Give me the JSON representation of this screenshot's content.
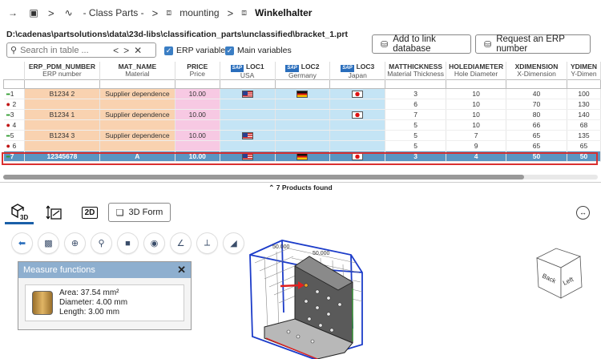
{
  "breadcrumb": {
    "items": [
      "- Class Parts -",
      "mounting",
      "Winkelhalter"
    ],
    "sep": ">"
  },
  "toolbar": {
    "path": "D:\\cadenas\\partsolutions\\data\\23d-libs\\classification_parts\\unclassified\\bracket_1.prt",
    "search_placeholder": "Search in table ...",
    "erp_variables": "ERP variables",
    "main_variables": "Main variables",
    "add_link_db": "Add to link database",
    "request_erp": "Request an ERP number"
  },
  "table": {
    "columns": [
      {
        "name": "ERP_PDM_NUMBER",
        "sub": "ERP number"
      },
      {
        "name": "MAT_NAME",
        "sub": "Material"
      },
      {
        "name": "PRICE",
        "sub": "Price"
      },
      {
        "name": "LOC1",
        "sub": "USA"
      },
      {
        "name": "LOC2",
        "sub": "Germany"
      },
      {
        "name": "LOC3",
        "sub": "Japan"
      },
      {
        "name": "MATTHICKNESS",
        "sub": "Material Thickness"
      },
      {
        "name": "HOLEDIAMETER",
        "sub": "Hole Diameter"
      },
      {
        "name": "XDIMENSION",
        "sub": "X-Dimension"
      },
      {
        "name": "YDIMEN",
        "sub": "Y-Dimen"
      }
    ],
    "sap_badge": "SAP",
    "rows": [
      {
        "idx": "1",
        "marker": "green",
        "erp": "B1234 2",
        "mat": "Supplier dependence",
        "price": "10.00",
        "loc1": "us",
        "loc2": "de",
        "loc3": "jp",
        "thick": "3",
        "hole": "10",
        "x": "40",
        "y": "100"
      },
      {
        "idx": "2",
        "marker": "red",
        "erp": "",
        "mat": "",
        "price": "",
        "loc1": "",
        "loc2": "",
        "loc3": "",
        "thick": "6",
        "hole": "10",
        "x": "70",
        "y": "130"
      },
      {
        "idx": "3",
        "marker": "green",
        "erp": "B1234 1",
        "mat": "Supplier dependence",
        "price": "10.00",
        "loc1": "",
        "loc2": "",
        "loc3": "jp",
        "thick": "7",
        "hole": "10",
        "x": "80",
        "y": "140"
      },
      {
        "idx": "4",
        "marker": "red",
        "erp": "",
        "mat": "",
        "price": "",
        "loc1": "",
        "loc2": "",
        "loc3": "",
        "thick": "5",
        "hole": "10",
        "x": "66",
        "y": "68"
      },
      {
        "idx": "5",
        "marker": "green",
        "erp": "B1234 3",
        "mat": "Supplier dependence",
        "price": "10.00",
        "loc1": "us",
        "loc2": "",
        "loc3": "",
        "thick": "5",
        "hole": "7",
        "x": "65",
        "y": "135"
      },
      {
        "idx": "6",
        "marker": "red",
        "erp": "",
        "mat": "",
        "price": "",
        "loc1": "",
        "loc2": "",
        "loc3": "",
        "thick": "5",
        "hole": "9",
        "x": "65",
        "y": "65"
      },
      {
        "idx": "7",
        "marker": "green",
        "erp": "12345678",
        "mat": "A",
        "price": "10.00",
        "loc1": "us",
        "loc2": "de",
        "loc3": "jp",
        "thick": "3",
        "hole": "4",
        "x": "50",
        "y": "50",
        "selected": true
      }
    ],
    "found_text": "7 Products found"
  },
  "viewtabs": {
    "tab_3d": "3D",
    "tab_2d": "2D",
    "form_button": "3D Form"
  },
  "measure": {
    "title": "Measure functions",
    "area": "Area: 37.54 mm²",
    "diameter": "Diameter: 4.00 mm",
    "length": "Length: 3.00 mm"
  },
  "navcube": {
    "back": "Back",
    "left": "Left"
  },
  "colors": {
    "selected_row": "#5a95c2",
    "selection_frame": "#d93030",
    "erp_col": "#f9d2b0",
    "price_col": "#f7c9e3",
    "loc_col": "#c4e4f5",
    "measure_header": "#8eafcf",
    "accent": "#1a5fa8"
  }
}
